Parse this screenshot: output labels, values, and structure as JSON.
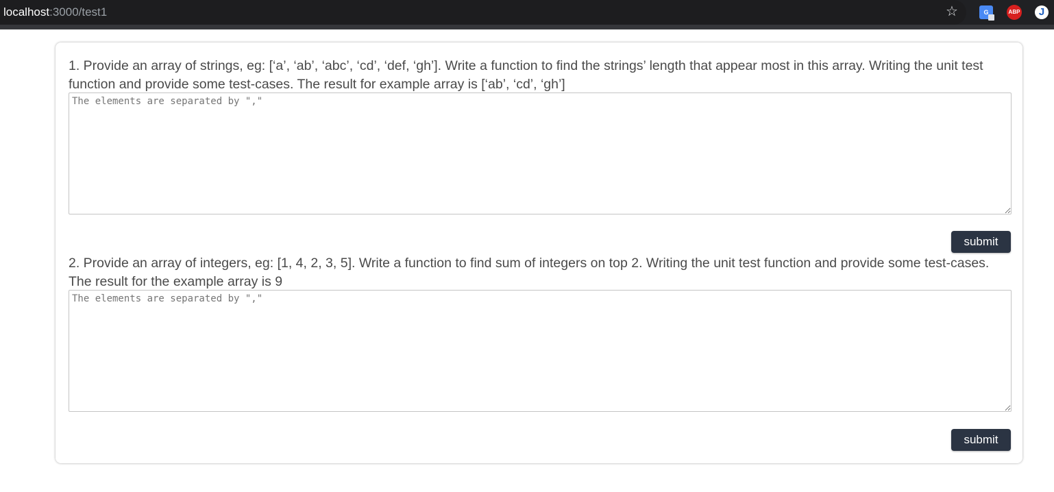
{
  "browser": {
    "url_host": "localhost",
    "url_path": ":3000/test1",
    "extensions": [
      "translate-icon",
      "adblock-plus-icon",
      "j-extension-icon"
    ],
    "extension_labels": {
      "abp": "ABP",
      "j": "J"
    }
  },
  "questions": [
    {
      "text": "1. Provide an array of strings, eg: [‘a’, ‘ab’, ‘abc’, ‘cd’, ‘def, ‘gh’]. Write a function to find the strings’ length that appear most in this array. Writing the unit test function and provide some test-cases. The result for example array is [‘ab’, ‘cd’, ‘gh’]",
      "placeholder": "The elements are separated by \",\"",
      "value": "",
      "submit_label": "submit"
    },
    {
      "text": "2. Provide an array of integers, eg: [1, 4, 2, 3, 5]. Write a function to find sum of integers on top 2. Writing the unit test function and provide some test-cases. The result for the example array is 9",
      "placeholder": "The elements are separated by \",\"",
      "value": "",
      "submit_label": "submit"
    }
  ],
  "colors": {
    "button_bg": "#2b3443",
    "text": "#4a4a4a",
    "browser_bar": "#202124"
  }
}
